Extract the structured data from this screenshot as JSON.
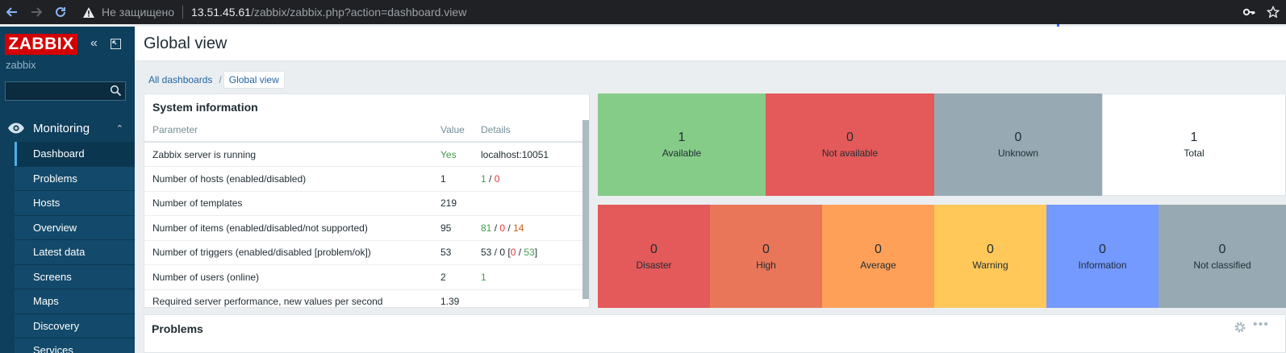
{
  "browser": {
    "insecure_label": "Не защищено",
    "url_host": "13.51.45.61",
    "url_path": "/zabbix/zabbix.php?action=dashboard.view"
  },
  "sidebar": {
    "logo": "ZABBIX",
    "server_name": "zabbix",
    "section": "Monitoring",
    "items": [
      {
        "label": "Dashboard",
        "active": true
      },
      {
        "label": "Problems"
      },
      {
        "label": "Hosts"
      },
      {
        "label": "Overview"
      },
      {
        "label": "Latest data"
      },
      {
        "label": "Screens"
      },
      {
        "label": "Maps"
      },
      {
        "label": "Discovery"
      },
      {
        "label": "Services"
      }
    ]
  },
  "page": {
    "title": "Global view",
    "breadcrumb": {
      "all": "All dashboards",
      "sep": "/",
      "current": "Global view"
    }
  },
  "system_info": {
    "title": "System information",
    "columns": [
      "Parameter",
      "Value",
      "Details"
    ],
    "rows": [
      {
        "param": "Zabbix server is running",
        "value": "Yes",
        "details": "localhost:10051"
      },
      {
        "param": "Number of hosts (enabled/disabled)",
        "value": "1",
        "d1": "1",
        "d2": "0"
      },
      {
        "param": "Number of templates",
        "value": "219",
        "details": ""
      },
      {
        "param": "Number of items (enabled/disabled/not supported)",
        "value": "95",
        "d1": "81",
        "d2": "0",
        "d3": "14"
      },
      {
        "param": "Number of triggers (enabled/disabled [problem/ok])",
        "value": "53",
        "d_pre": "53 / 0 [",
        "d_prob": "0",
        "d_mid": " / ",
        "d_ok": "53",
        "d_post": "]"
      },
      {
        "param": "Number of users (online)",
        "value": "2",
        "d1": "1"
      },
      {
        "param": "Required server performance, new values per second",
        "value": "1.39",
        "details": ""
      }
    ]
  },
  "host_availability": [
    {
      "count": "1",
      "label": "Available",
      "color": "#86cc89"
    },
    {
      "count": "0",
      "label": "Not available",
      "color": "#e45959"
    },
    {
      "count": "0",
      "label": "Unknown",
      "color": "#97aab3"
    },
    {
      "count": "1",
      "label": "Total",
      "color": "#ffffff"
    }
  ],
  "problems_by_severity": [
    {
      "count": "0",
      "label": "Disaster",
      "color": "#e45959"
    },
    {
      "count": "0",
      "label": "High",
      "color": "#e97659"
    },
    {
      "count": "0",
      "label": "Average",
      "color": "#ffa059"
    },
    {
      "count": "0",
      "label": "Warning",
      "color": "#ffc859"
    },
    {
      "count": "0",
      "label": "Information",
      "color": "#7499ff"
    },
    {
      "count": "0",
      "label": "Not classified",
      "color": "#97aab3"
    }
  ],
  "problems_widget": {
    "title": "Problems",
    "more": "•••"
  }
}
